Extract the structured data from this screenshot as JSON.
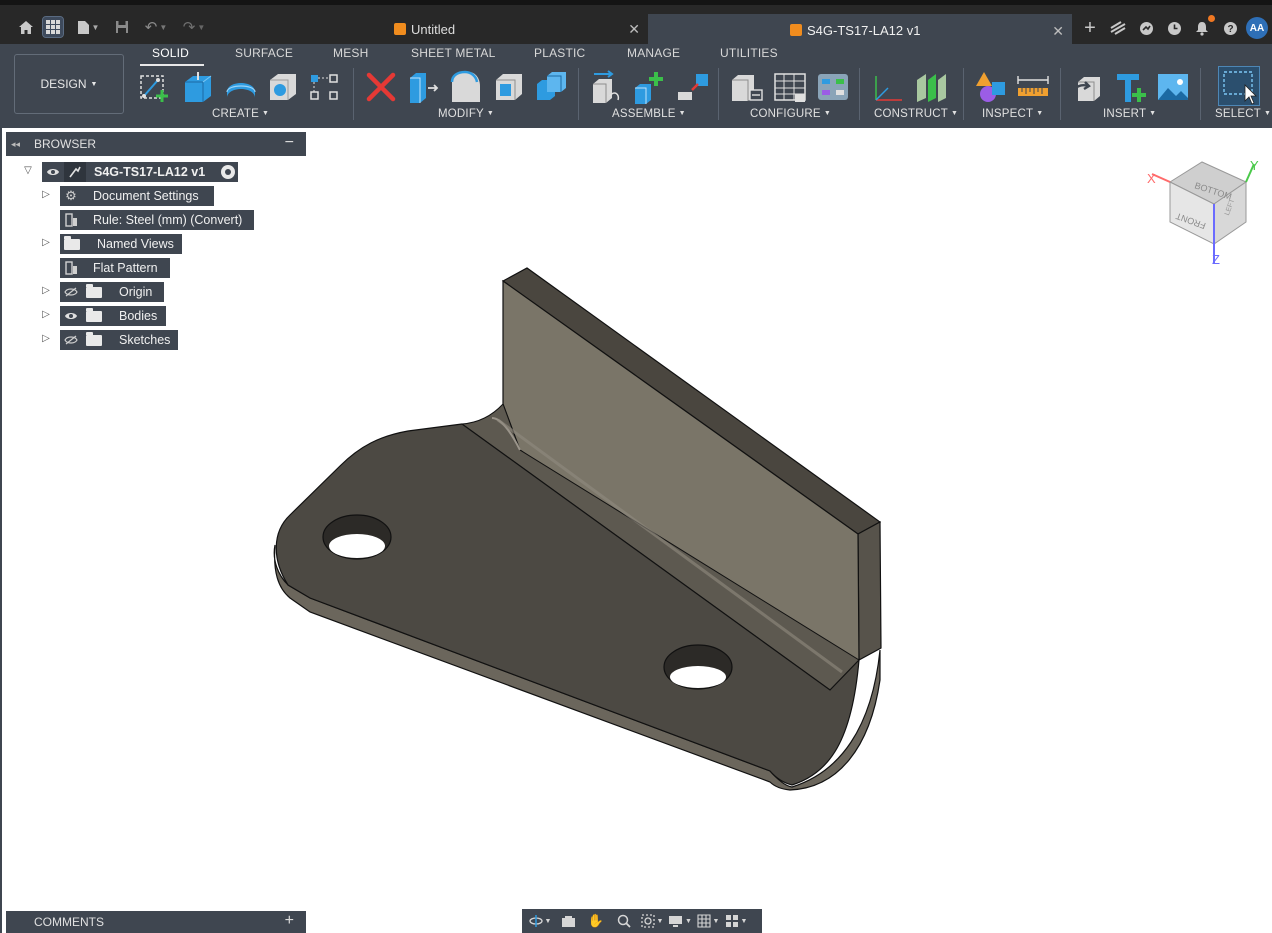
{
  "titlebar": {
    "tabs": [
      {
        "label": "Untitled",
        "active": false
      },
      {
        "label": "S4G-TS17-LA12 v1",
        "active": true
      }
    ],
    "avatar_initials": "AA"
  },
  "toolbar": {
    "workspace_label": "DESIGN",
    "workspace_tabs": [
      "SOLID",
      "SURFACE",
      "MESH",
      "SHEET METAL",
      "PLASTIC",
      "MANAGE",
      "UTILITIES"
    ],
    "groups": [
      "CREATE",
      "MODIFY",
      "ASSEMBLE",
      "CONFIGURE",
      "CONSTRUCT",
      "INSPECT",
      "INSERT",
      "SELECT"
    ]
  },
  "browser": {
    "title": "BROWSER",
    "root": "S4G-TS17-LA12 v1",
    "items": [
      {
        "label": "Document Settings"
      },
      {
        "label": "Rule: Steel (mm) (Convert)"
      },
      {
        "label": "Named Views"
      },
      {
        "label": "Flat Pattern"
      },
      {
        "label": "Origin"
      },
      {
        "label": "Bodies"
      },
      {
        "label": "Sketches"
      }
    ]
  },
  "viewcube": {
    "faces": [
      "BOTTOM",
      "FRONT",
      "LEFT"
    ],
    "axes": [
      "X",
      "Y",
      "Z"
    ]
  },
  "comments": {
    "title": "COMMENTS"
  },
  "colors": {
    "toolbar_bg": "#3f4650",
    "titlebar_bg": "#282828",
    "accent_orange": "#f08c1e",
    "accent_blue": "#2e9be0"
  }
}
